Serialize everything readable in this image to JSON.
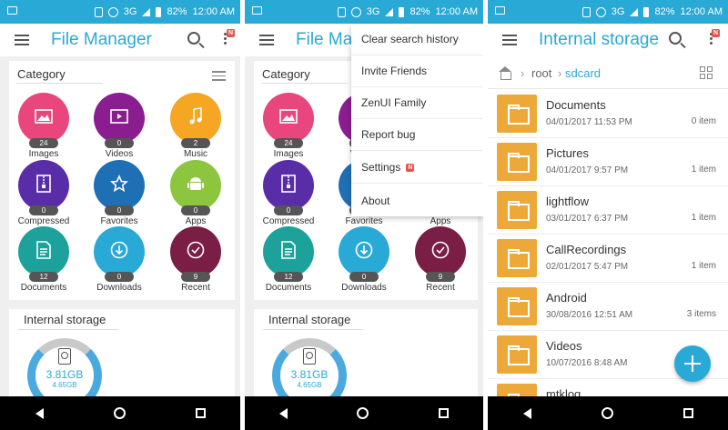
{
  "statusbar": {
    "network": "3G",
    "battery": "82%",
    "time": "12:00 AM"
  },
  "appbar": {
    "title_file_manager": "File Manager",
    "title_file_manager_cut": "File Mar",
    "title_internal_storage": "Internal storage",
    "notification_badge": "N"
  },
  "category": {
    "title": "Category",
    "items": [
      {
        "label": "Images",
        "count": "24",
        "color": "#e8467c",
        "icon": "image-icon"
      },
      {
        "label": "Videos",
        "count": "0",
        "color": "#8a1d8f",
        "icon": "video-icon"
      },
      {
        "label": "Music",
        "count": "2",
        "color": "#f5a623",
        "icon": "music-icon"
      },
      {
        "label": "Compressed",
        "count": "0",
        "color": "#5a2da8",
        "icon": "compressed-icon"
      },
      {
        "label": "Favorites",
        "count": "0",
        "color": "#1f6fb5",
        "icon": "star-icon"
      },
      {
        "label": "Apps",
        "count": "0",
        "color": "#8cc63f",
        "icon": "android-icon"
      },
      {
        "label": "Documents",
        "count": "12",
        "color": "#1da19b",
        "icon": "document-icon"
      },
      {
        "label": "Downloads",
        "count": "0",
        "color": "#29a9d6",
        "icon": "download-icon"
      },
      {
        "label": "Recent",
        "count": "9",
        "color": "#7a1e45",
        "icon": "check-icon"
      }
    ]
  },
  "storage": {
    "title": "Internal storage",
    "used": "3.81GB",
    "total": "4.65GB"
  },
  "menu": {
    "items": [
      {
        "label": "Clear search history"
      },
      {
        "label": "Invite Friends"
      },
      {
        "label": "ZenUI Family"
      },
      {
        "label": "Report bug"
      },
      {
        "label": "Settings",
        "badge": "N"
      },
      {
        "label": "About"
      }
    ]
  },
  "breadcrumb": {
    "root": "root",
    "current": "sdcard"
  },
  "files": [
    {
      "name": "Documents",
      "date": "04/01/2017 11:53 PM",
      "count": "0 item"
    },
    {
      "name": "Pictures",
      "date": "04/01/2017 9:57 PM",
      "count": "1 item"
    },
    {
      "name": "lightflow",
      "date": "03/01/2017 6:37 PM",
      "count": "1 item"
    },
    {
      "name": "CallRecordings",
      "date": "02/01/2017 5:47 PM",
      "count": "1 item"
    },
    {
      "name": "Android",
      "date": "30/08/2016 12:51 AM",
      "count": "3 items"
    },
    {
      "name": "Videos",
      "date": "10/07/2016 8:48 AM",
      "count": ""
    },
    {
      "name": "mtklog",
      "date": "",
      "count": ""
    }
  ],
  "colors": {
    "accent": "#29a9d6",
    "folder": "#eca93a",
    "badge": "#e5534b"
  }
}
